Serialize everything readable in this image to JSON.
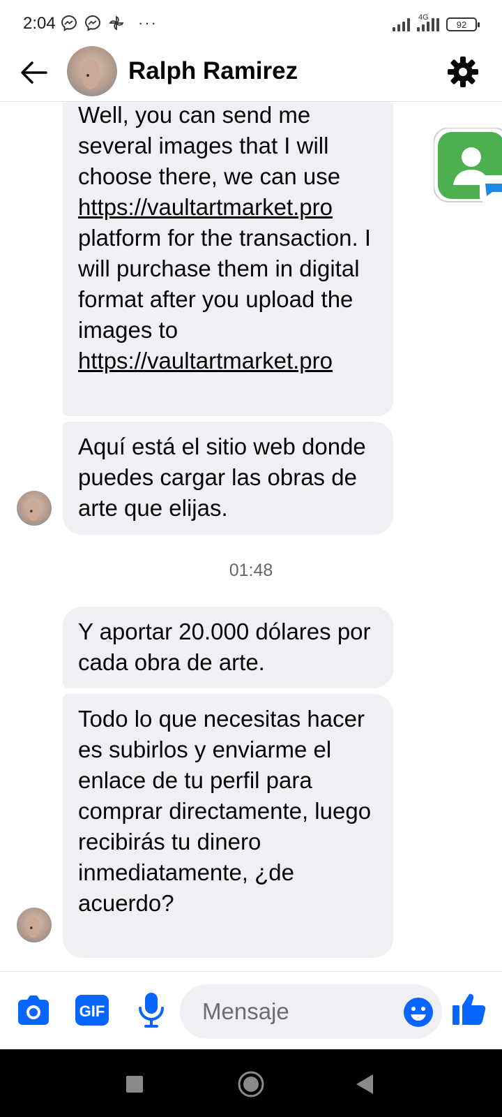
{
  "status_bar": {
    "time": "2:04",
    "more_indicator": "···",
    "network": "4G",
    "battery": "92",
    "notification_icons": [
      "messenger-icon",
      "messenger-icon",
      "pinwheel-icon"
    ]
  },
  "header": {
    "contact_name": "Ralph Ramirez",
    "icons": [
      "back-arrow-icon",
      "gear-icon"
    ]
  },
  "messages": [
    {
      "parts": [
        {
          "text": "Well, you can send me several images that I will choose there, we can use "
        },
        {
          "link": "https://vaultartmarket.pro"
        },
        {
          "text": " platform for the transaction.  I will purchase them in digital format after you upload the images to "
        },
        {
          "link": "https://vaultartmarket.pro"
        }
      ]
    },
    {
      "text": "Aquí está el sitio web donde puedes cargar las obras de arte que elijas."
    },
    {
      "text": "Y aportar 20.000 dólares por cada obra de arte."
    },
    {
      "text": "Todo lo que necesitas hacer es subirlos y enviarme el enlace de tu perfil para comprar directamente, luego recibirás tu dinero inmediatamente, ¿de acuerdo?"
    }
  ],
  "timestamp": "01:48",
  "composer": {
    "placeholder": "Mensaje",
    "gif_label": "GIF",
    "icons": [
      "camera-icon",
      "gif-icon",
      "microphone-icon",
      "emoji-icon",
      "thumbs-up-icon"
    ]
  },
  "colors": {
    "accent": "#0866ff",
    "bubble": "#f0f0f4",
    "text": "#050505",
    "contact_app_green": "#4caf50"
  }
}
